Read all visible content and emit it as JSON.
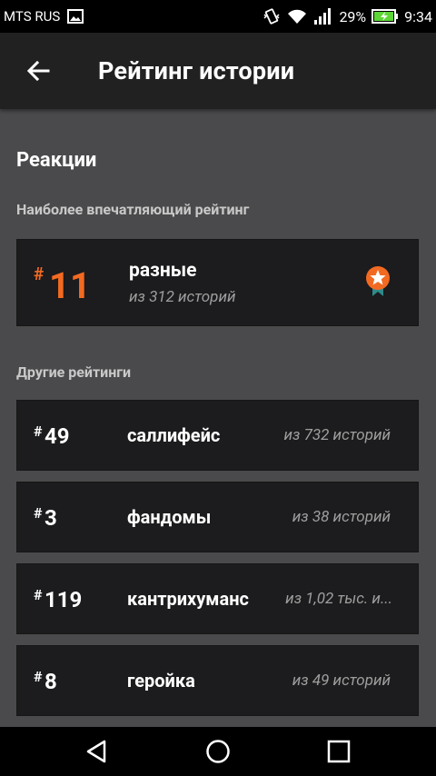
{
  "status_bar": {
    "carrier": "MTS RUS",
    "battery": "29%",
    "time": "9:34",
    "icons": [
      "image-icon",
      "vibrate-icon",
      "wifi-icon",
      "signal-icon",
      "battery-charging-icon"
    ]
  },
  "app_bar": {
    "back_icon": "arrow-back-icon",
    "title": "Рейтинг истории"
  },
  "reactions": {
    "title": "Реакции",
    "featured_label": "Наиболее впечатляющий рейтинг",
    "featured": {
      "hash": "#",
      "rank": "11",
      "category": "разные",
      "subtitle": "из 312 историй",
      "badge_icon": "award-ribbon-icon",
      "accent": "#f26a21"
    },
    "other_label": "Другие рейтинги",
    "others": [
      {
        "hash": "#",
        "rank": "49",
        "category": "саллифейс",
        "count": "из 732 историй"
      },
      {
        "hash": "#",
        "rank": "3",
        "category": "фандомы",
        "count": "из 38 историй"
      },
      {
        "hash": "#",
        "rank": "119",
        "category": "кантрихуманс",
        "count": "из 1,02 тыс. и..."
      },
      {
        "hash": "#",
        "rank": "8",
        "category": "геройка",
        "count": "из 49 историй"
      }
    ]
  },
  "nav_bar": {
    "icons": [
      "back-triangle-icon",
      "home-circle-icon",
      "recents-square-icon"
    ]
  }
}
